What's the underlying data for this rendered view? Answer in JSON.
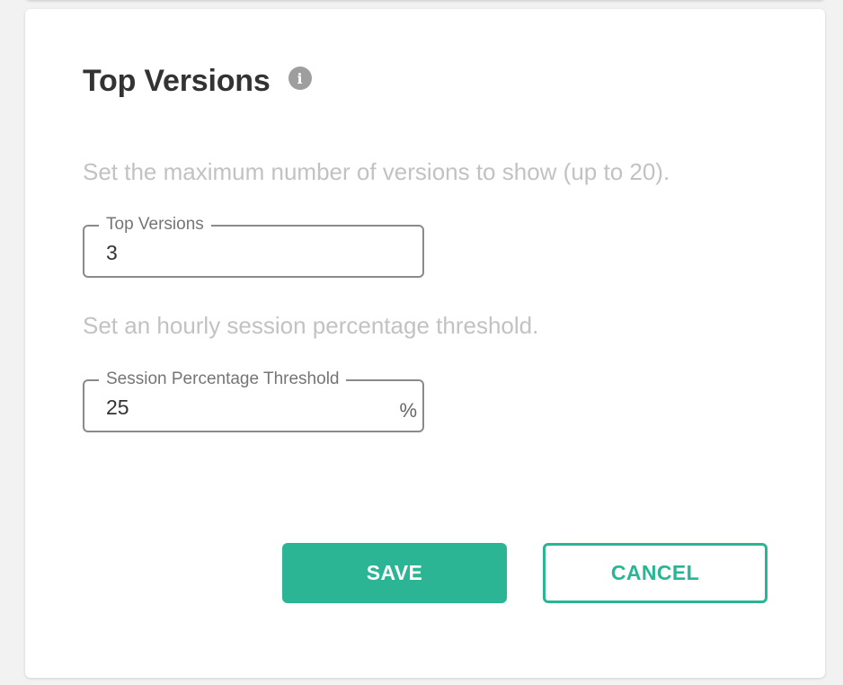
{
  "card": {
    "title": "Top Versions",
    "info_icon": "info-icon"
  },
  "top_versions": {
    "description": "Set the maximum number of versions to show (up to 20).",
    "label": "Top Versions",
    "value": "3"
  },
  "session_threshold": {
    "description": "Set an hourly session percentage threshold.",
    "label": "Session Percentage Threshold",
    "value": "25",
    "suffix": "%"
  },
  "actions": {
    "save_label": "SAVE",
    "cancel_label": "CANCEL"
  },
  "colors": {
    "accent": "#2bb594",
    "title": "#333333",
    "description": "#c2c2c2",
    "field_border": "#8a8a8a",
    "info_icon_bg": "#9e9e9e"
  }
}
